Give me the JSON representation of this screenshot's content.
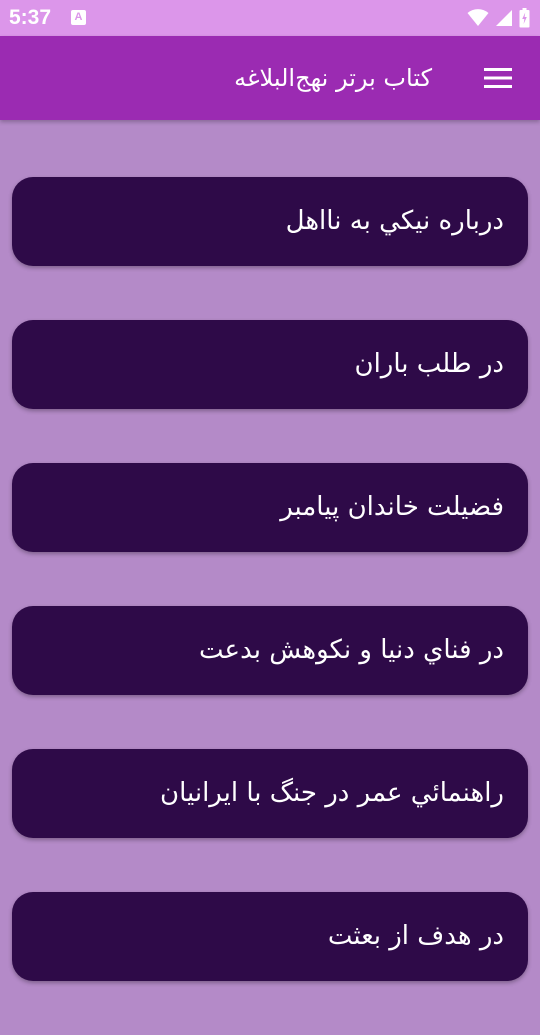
{
  "status_bar": {
    "time": "5:37",
    "notification_letter": "A",
    "icons": [
      "wifi-icon",
      "signal-icon",
      "battery-icon"
    ]
  },
  "app_bar": {
    "title": "کتاب برتر نهج‌البلاغه",
    "menu_icon": "menu-icon"
  },
  "items": [
    {
      "label": "درباره نيکي به نااهل"
    },
    {
      "label": "در طلب باران"
    },
    {
      "label": "فضيلت خاندان پيامبر"
    },
    {
      "label": "در فناي دنيا و نکوهش بدعت"
    },
    {
      "label": "راهنمائي عمر در جنگ با ايرانيان"
    },
    {
      "label": "در هدف از بعثت"
    }
  ],
  "colors": {
    "status_bar": "#dc96ea",
    "app_bar": "#9b2bb2",
    "background": "#b48ac8",
    "card": "#2e0a48",
    "text": "#ffffff"
  }
}
